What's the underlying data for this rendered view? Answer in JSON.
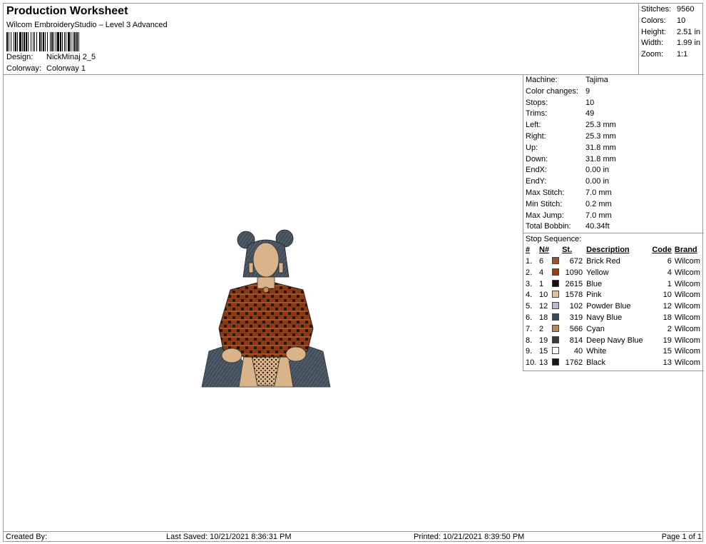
{
  "header": {
    "title": "Production Worksheet",
    "subtitle": "Wilcom EmbroideryStudio – Level 3 Advanced",
    "design_label": "Design:",
    "design_value": "NickMinaj 2_5",
    "colorway_label": "Colorway:",
    "colorway_value": "Colorway 1"
  },
  "summary": [
    {
      "label": "Stitches:",
      "value": "9560"
    },
    {
      "label": "Colors:",
      "value": "10"
    },
    {
      "label": "Height:",
      "value": "2.51 in"
    },
    {
      "label": "Width:",
      "value": "1.99 in"
    },
    {
      "label": "Zoom:",
      "value": "1:1"
    }
  ],
  "params": [
    {
      "label": "Machine:",
      "value": "Tajima"
    },
    {
      "label": "Color changes:",
      "value": "9"
    },
    {
      "label": "Stops:",
      "value": "10"
    },
    {
      "label": "Trims:",
      "value": "49"
    },
    {
      "label": "Left:",
      "value": "25.3 mm"
    },
    {
      "label": "Right:",
      "value": "25.3 mm"
    },
    {
      "label": "Up:",
      "value": "31.8 mm"
    },
    {
      "label": "Down:",
      "value": "31.8 mm"
    },
    {
      "label": "EndX:",
      "value": "0.00 in"
    },
    {
      "label": "EndY:",
      "value": "0.00 in"
    },
    {
      "label": "Max Stitch:",
      "value": "7.0 mm"
    },
    {
      "label": "Min Stitch:",
      "value": "0.2 mm"
    },
    {
      "label": "Max Jump:",
      "value": "7.0 mm"
    },
    {
      "label": "Total Bobbin:",
      "value": "40.34ft"
    }
  ],
  "stop_sequence": {
    "heading": "Stop Sequence:",
    "columns": {
      "idx": "#",
      "color": "N#",
      "stitches": "St.",
      "description": "Description",
      "code": "Code",
      "brand": "Brand"
    },
    "rows": [
      {
        "idx": "1.",
        "color": "6",
        "swatch": "#a0522d",
        "stitches": "672",
        "description": "Brick Red",
        "code": "6",
        "brand": "Wilcom"
      },
      {
        "idx": "2.",
        "color": "4",
        "swatch": "#a23a0f",
        "stitches": "1090",
        "description": "Yellow",
        "code": "4",
        "brand": "Wilcom"
      },
      {
        "idx": "3.",
        "color": "1",
        "swatch": "#1a0f08",
        "stitches": "2615",
        "description": "Blue",
        "code": "1",
        "brand": "Wilcom"
      },
      {
        "idx": "4.",
        "color": "10",
        "swatch": "#e8c09a",
        "stitches": "1578",
        "description": "Pink",
        "code": "10",
        "brand": "Wilcom"
      },
      {
        "idx": "5.",
        "color": "12",
        "swatch": "#b8b8d4",
        "stitches": "102",
        "description": "Powder Blue",
        "code": "12",
        "brand": "Wilcom"
      },
      {
        "idx": "6.",
        "color": "18",
        "swatch": "#3c4a5c",
        "stitches": "319",
        "description": "Navy Blue",
        "code": "18",
        "brand": "Wilcom"
      },
      {
        "idx": "7.",
        "color": "2",
        "swatch": "#b5895a",
        "stitches": "566",
        "description": "Cyan",
        "code": "2",
        "brand": "Wilcom"
      },
      {
        "idx": "8.",
        "color": "19",
        "swatch": "#333a40",
        "stitches": "814",
        "description": "Deep Navy Blue",
        "code": "19",
        "brand": "Wilcom"
      },
      {
        "idx": "9.",
        "color": "15",
        "swatch": "#ffffff",
        "stitches": "40",
        "description": "White",
        "code": "15",
        "brand": "Wilcom"
      },
      {
        "idx": "10.",
        "color": "13",
        "swatch": "#151515",
        "stitches": "1762",
        "description": "Black",
        "code": "13",
        "brand": "Wilcom"
      }
    ]
  },
  "footer": {
    "created_by": "Created By:",
    "last_saved": "Last Saved: 10/21/2021 8:36:31 PM",
    "printed": "Printed: 10/21/2021 8:39:50 PM",
    "page": "Page 1 of 1"
  }
}
